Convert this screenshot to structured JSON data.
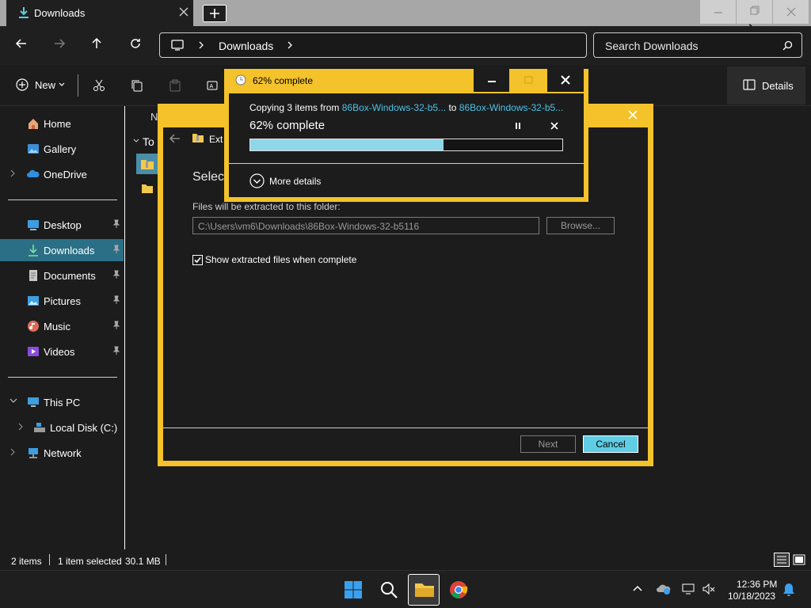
{
  "window": {
    "tab_title": "Downloads",
    "colors": {
      "accent": "#f4c22a",
      "selection": "#5fcde4",
      "link": "#4cc2e6"
    }
  },
  "address": {
    "crumb": "Downloads",
    "search_placeholder": "Search Downloads"
  },
  "toolbar": {
    "new_label": "New",
    "details_label": "Details"
  },
  "sidebar": {
    "items": [
      {
        "label": "Home",
        "icon": "home-icon"
      },
      {
        "label": "Gallery",
        "icon": "gallery-icon"
      },
      {
        "label": "OneDrive",
        "icon": "cloud-icon"
      },
      {
        "label": "Desktop",
        "icon": "desktop-icon"
      },
      {
        "label": "Downloads",
        "icon": "download-icon"
      },
      {
        "label": "Documents",
        "icon": "documents-icon"
      },
      {
        "label": "Pictures",
        "icon": "pictures-icon"
      },
      {
        "label": "Music",
        "icon": "music-icon"
      },
      {
        "label": "Videos",
        "icon": "videos-icon"
      },
      {
        "label": "This PC",
        "icon": "pc-icon"
      },
      {
        "label": "Local Disk (C:)",
        "icon": "disk-icon"
      },
      {
        "label": "Network",
        "icon": "network-icon"
      }
    ]
  },
  "filelist": {
    "col_header_partial": "N",
    "group_partial": "To"
  },
  "status": {
    "items_count": "2 items",
    "selected": "1 item selected",
    "size": "30.1 MB"
  },
  "extract_dialog": {
    "title_partial": "Ext",
    "heading_partial": "Selec",
    "folder_label": "Files will be extracted to this folder:",
    "folder_value": "C:\\Users\\vm6\\Downloads\\86Box-Windows-32-b5116",
    "browse_label": "Browse...",
    "show_files_label": "Show extracted files when complete",
    "show_files_checked": true,
    "next_label": "Next",
    "cancel_label": "Cancel"
  },
  "progress_dialog": {
    "title": "62% complete",
    "copying_prefix": "Copying 3 items from ",
    "source": "86Box-Windows-32-b5...",
    "to_word": " to ",
    "destination": "86Box-Windows-32-b5...",
    "percent_text": "62% complete",
    "progress": 0.62,
    "more_details_label": "More details"
  },
  "taskbar": {
    "time": "12:36 PM",
    "date": "10/18/2023"
  }
}
